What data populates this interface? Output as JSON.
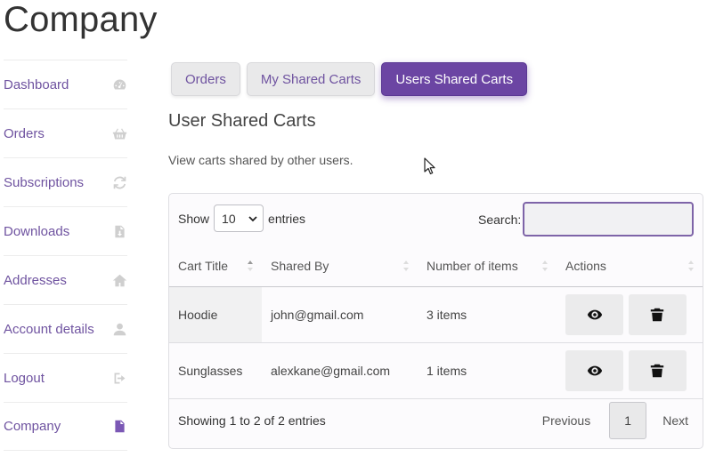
{
  "page": {
    "title": "Company"
  },
  "sidebar": {
    "items": [
      {
        "label": "Dashboard",
        "icon": "dashboard-gauge-icon"
      },
      {
        "label": "Orders",
        "icon": "basket-icon"
      },
      {
        "label": "Subscriptions",
        "icon": "refresh-icon"
      },
      {
        "label": "Downloads",
        "icon": "file-download-icon"
      },
      {
        "label": "Addresses",
        "icon": "home-icon"
      },
      {
        "label": "Account details",
        "icon": "user-icon"
      },
      {
        "label": "Logout",
        "icon": "logout-icon"
      },
      {
        "label": "Company",
        "icon": "document-icon",
        "active": true
      }
    ]
  },
  "tabs": [
    {
      "label": "Orders"
    },
    {
      "label": "My Shared Carts"
    },
    {
      "label": "Users Shared Carts",
      "active": true
    }
  ],
  "section": {
    "title": "User Shared Carts",
    "description": "View carts shared by other users."
  },
  "table": {
    "show_label": "Show",
    "entries_value": "10",
    "entries_label": "entries",
    "search_label": "Search:",
    "search_value": "",
    "columns": [
      "Cart Title",
      "Shared By",
      "Number of items",
      "Actions"
    ],
    "rows": [
      {
        "title": "Hoodie",
        "shared_by": "john@gmail.com",
        "items": "3 items"
      },
      {
        "title": "Sunglasses",
        "shared_by": "alexkane@gmail.com",
        "items": "1 items"
      }
    ],
    "info": "Showing 1 to 2 of 2 entries",
    "pagination": {
      "previous": "Previous",
      "current": "1",
      "next": "Next"
    }
  },
  "colors": {
    "accent": "#6b45a3",
    "link": "#6f53a0"
  }
}
